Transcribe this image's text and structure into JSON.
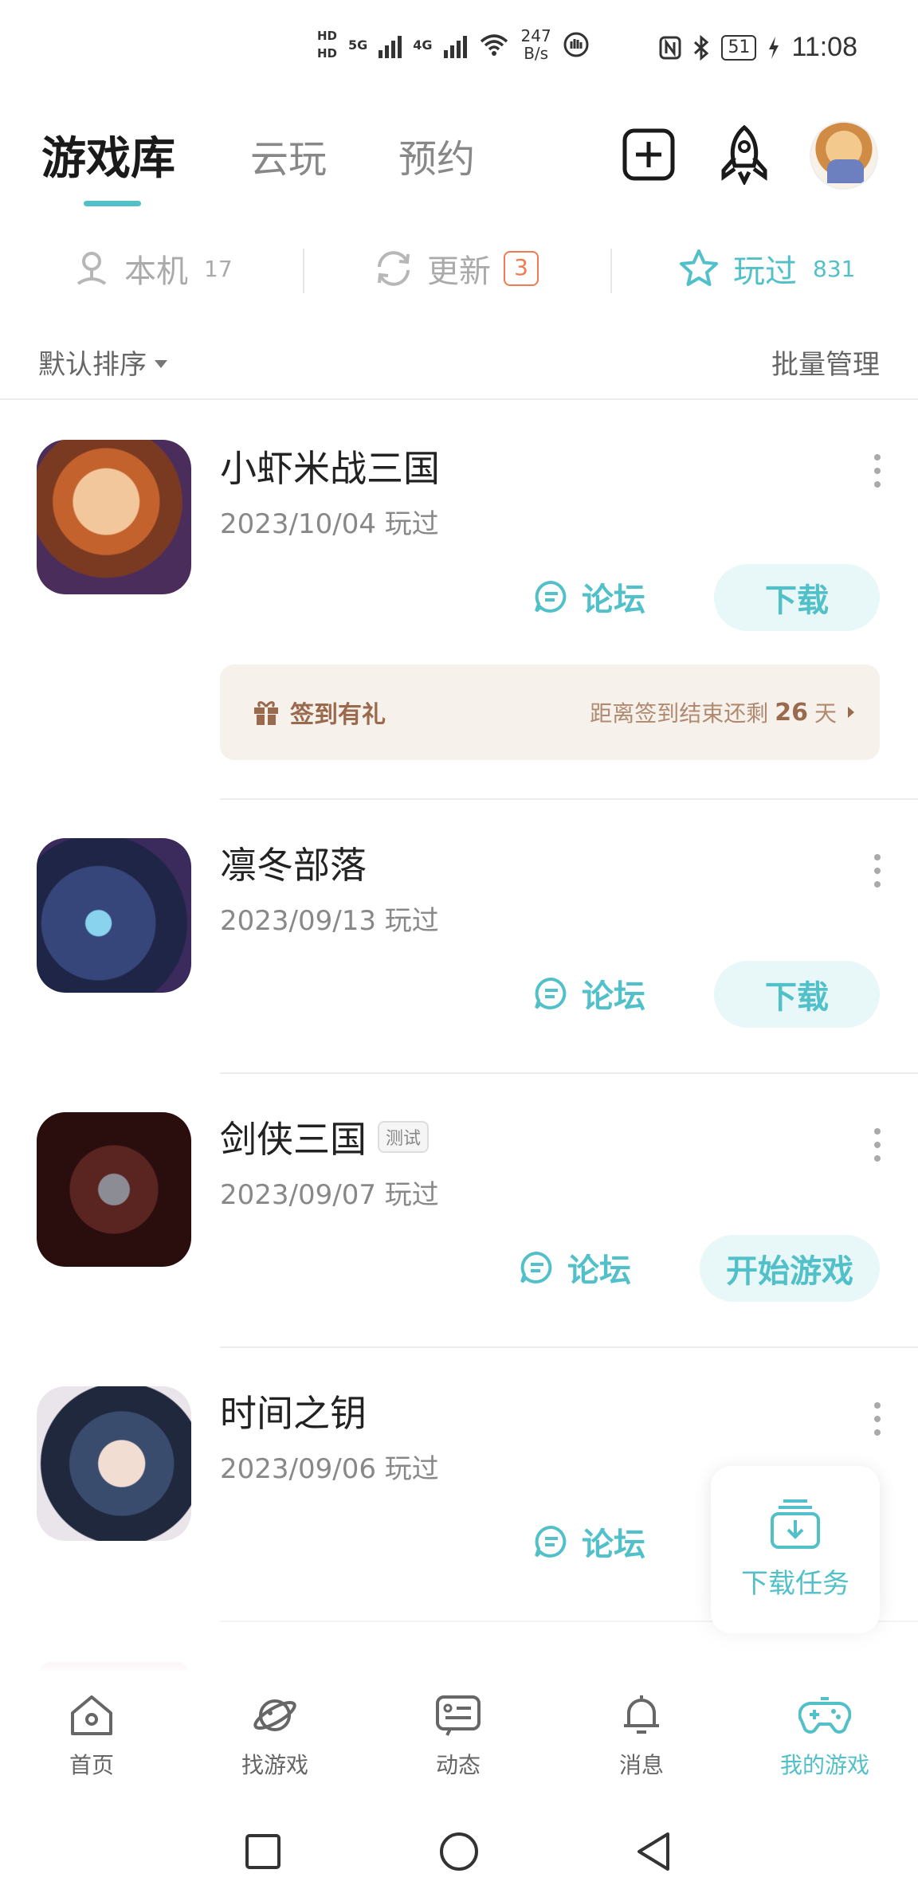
{
  "status_bar": {
    "hd1": "HD",
    "hd2": "HD",
    "net1": "5G",
    "net2": "4G",
    "speed_value": "247",
    "speed_unit": "B/s",
    "battery": "51",
    "time": "11:08"
  },
  "header": {
    "tabs": [
      {
        "label": "游戏库"
      },
      {
        "label": "云玩"
      },
      {
        "label": "预约"
      }
    ]
  },
  "filters": {
    "local": {
      "label": "本机",
      "count": "17"
    },
    "update": {
      "label": "更新",
      "count": "3"
    },
    "played": {
      "label": "玩过",
      "count": "831"
    }
  },
  "sort": {
    "label": "默认排序",
    "batch": "批量管理"
  },
  "games": [
    {
      "title": "小虾米战三国",
      "date": "2023/10/04 玩过",
      "forum": "论坛",
      "action": "下载"
    },
    {
      "title": "凛冬部落",
      "date": "2023/09/13 玩过",
      "forum": "论坛",
      "action": "下载"
    },
    {
      "title": "剑侠三国",
      "tag": "测试",
      "date": "2023/09/07 玩过",
      "forum": "论坛",
      "action": "开始游戏"
    },
    {
      "title": "时间之钥",
      "date": "2023/09/06 玩过",
      "forum": "论坛"
    }
  ],
  "checkin": {
    "label": "签到有礼",
    "prefix": "距离签到结束还剩",
    "days": "26",
    "suffix": "天"
  },
  "download_task": {
    "label": "下载任务"
  },
  "bottom_nav": {
    "items": [
      {
        "label": "首页"
      },
      {
        "label": "找游戏"
      },
      {
        "label": "动态"
      },
      {
        "label": "消息"
      },
      {
        "label": "我的游戏"
      }
    ]
  },
  "colors": {
    "accent": "#52c0c8",
    "badge": "#f07b52",
    "checkin_bg": "#f7f1ec",
    "checkin_text": "#9a6a4e"
  }
}
